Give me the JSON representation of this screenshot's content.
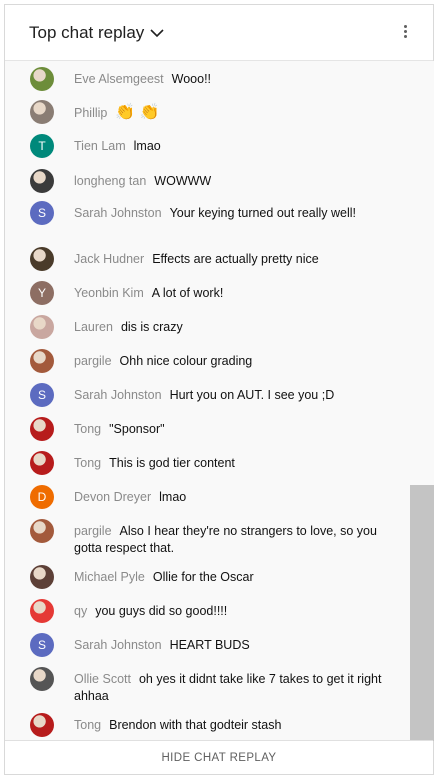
{
  "header": {
    "title": "Top chat replay",
    "dropdown_icon": "chevron-down-icon",
    "more_icon": "more-vert-icon"
  },
  "messages": [
    {
      "author": "Eve Alsemgeest",
      "text": "Wooo!!",
      "avatar": {
        "kind": "image",
        "color": "#6d8d3a"
      }
    },
    {
      "author": "Phillip",
      "text": "👏 👏",
      "avatar": {
        "kind": "image",
        "color": "#8a7d74"
      }
    },
    {
      "author": "Tien Lam",
      "text": "lmao",
      "avatar": {
        "kind": "letter",
        "letter": "T",
        "color": "#00897b"
      }
    },
    {
      "author": "longheng tan",
      "text": "WOWWW",
      "avatar": {
        "kind": "image",
        "color": "#3b3b3b"
      }
    },
    {
      "author": "Sarah Johnston",
      "text": "Your keying turned out really well!",
      "avatar": {
        "kind": "letter",
        "letter": "S",
        "color": "#5c6bc0"
      }
    },
    {
      "author": "Jack Hudner",
      "text": "Effects are actually pretty nice",
      "avatar": {
        "kind": "image",
        "color": "#4a3b2a"
      }
    },
    {
      "author": "Yeonbin Kim",
      "text": "A lot of work!",
      "avatar": {
        "kind": "letter",
        "letter": "Y",
        "color": "#8d6e63"
      }
    },
    {
      "author": "Lauren",
      "text": "dis is crazy",
      "avatar": {
        "kind": "image",
        "color": "#c9a7a0"
      }
    },
    {
      "author": "pargile",
      "text": "Ohh nice colour grading",
      "avatar": {
        "kind": "image",
        "color": "#a35a3c"
      }
    },
    {
      "author": "Sarah Johnston",
      "text": "Hurt you on AUT. I see you ;D",
      "avatar": {
        "kind": "letter",
        "letter": "S",
        "color": "#5c6bc0"
      }
    },
    {
      "author": "Tong",
      "text": "\"Sponsor\"",
      "avatar": {
        "kind": "image",
        "color": "#b71c1c"
      }
    },
    {
      "author": "Tong",
      "text": "This is god tier content",
      "avatar": {
        "kind": "image",
        "color": "#b71c1c"
      }
    },
    {
      "author": "Devon Dreyer",
      "text": "lmao",
      "avatar": {
        "kind": "letter",
        "letter": "D",
        "color": "#ef6c00"
      }
    },
    {
      "author": "pargile",
      "text": "Also I hear they're no strangers to love, so you gotta respect that.",
      "avatar": {
        "kind": "image",
        "color": "#a35a3c"
      }
    },
    {
      "author": "Michael Pyle",
      "text": "Ollie for the Oscar",
      "avatar": {
        "kind": "image",
        "color": "#5d4037"
      }
    },
    {
      "author": "qy",
      "text": "you guys did so good!!!!",
      "avatar": {
        "kind": "image",
        "color": "#e53935"
      }
    },
    {
      "author": "Sarah Johnston",
      "text": "HEART BUDS",
      "avatar": {
        "kind": "letter",
        "letter": "S",
        "color": "#5c6bc0"
      }
    },
    {
      "author": "Ollie Scott",
      "text": "oh yes it didnt take like 7 takes to get it right ahhaa",
      "avatar": {
        "kind": "image",
        "color": "#555555"
      }
    },
    {
      "author": "Tong",
      "text": "Brendon with that godteir stash",
      "avatar": {
        "kind": "image",
        "color": "#b71c1c"
      }
    }
  ],
  "footer": {
    "hide_label": "HIDE CHAT REPLAY"
  }
}
